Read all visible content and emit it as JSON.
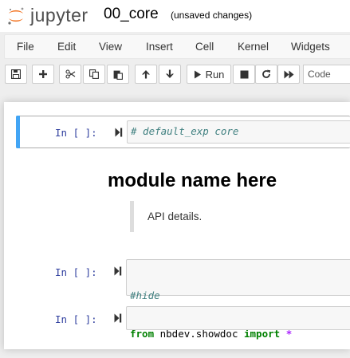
{
  "header": {
    "logo_text": "jupyter",
    "notebook_name": "00_core",
    "save_status": "(unsaved changes)"
  },
  "menubar": {
    "items": [
      "File",
      "Edit",
      "View",
      "Insert",
      "Cell",
      "Kernel",
      "Widgets"
    ]
  },
  "toolbar": {
    "buttons": [
      "save-icon",
      "plus-icon",
      "cut-icon",
      "copy-icon",
      "paste-icon",
      "arrow-up-icon",
      "arrow-down-icon"
    ],
    "run_label": "Run",
    "other_buttons": [
      "stop-icon",
      "restart-icon",
      "fast-forward-icon"
    ],
    "cell_type": "Code"
  },
  "cells": [
    {
      "prompt": "In [ ]:",
      "code": "# default_exp core",
      "selected": true
    },
    {
      "markdown_heading": "module name here",
      "markdown_quote": "API details."
    },
    {
      "prompt": "In [ ]:",
      "code_line1": "#hide",
      "code_line2_keyword1": "from",
      "code_line2_module": " nbdev.showdoc ",
      "code_line2_keyword2": "import",
      "code_line2_star": "*"
    },
    {
      "prompt": "In [ ]:",
      "code": ""
    }
  ],
  "colors": {
    "selected_bar": "#42a5f5",
    "prompt": "#303f9f",
    "comment": "#408080",
    "keyword": "#008000",
    "operator": "#aa22ff"
  }
}
